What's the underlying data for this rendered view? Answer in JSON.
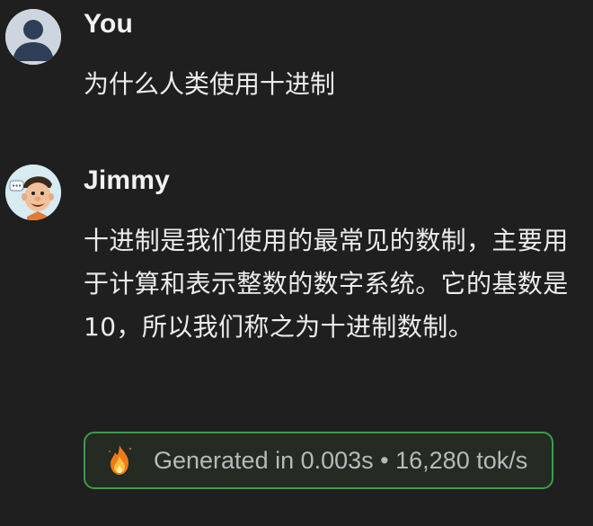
{
  "conversation": {
    "messages": [
      {
        "sender": "You",
        "avatar_icon": "user-silhouette-icon",
        "text": "为什么人类使用十进制"
      },
      {
        "sender": "Jimmy",
        "avatar_icon": "cartoon-man-avatar-icon",
        "text": "十进制是我们使用的最常见的数制，主要用于计算和表示整数的数字系统。它的基数是10，所以我们称之为十进制数制。",
        "generation_stats": {
          "icon": "fire-icon",
          "text": "Generated in 0.003s • 16,280 tok/s"
        }
      }
    ]
  },
  "colors": {
    "background": "#1f1f1f",
    "stats_border": "#3f9a4a",
    "text": "#ececec",
    "muted_text": "#b9b9b9"
  }
}
